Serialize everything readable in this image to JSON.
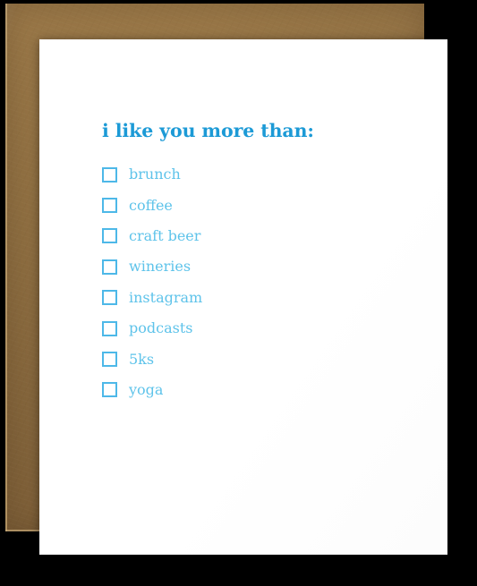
{
  "product_photo": {
    "background_color": "#000000",
    "envelope": {
      "label": "kraft-paper-envelope",
      "color": "#8e6e41"
    },
    "card": {
      "label": "greeting-card",
      "color": "#ffffff",
      "headline": "i like you more than:",
      "headline_color": "#1c9ad6",
      "item_color": "#5ec3ea",
      "checkbox_border_color": "#4db8e8",
      "checklist": [
        {
          "label": "brunch",
          "checked": false
        },
        {
          "label": "coffee",
          "checked": false
        },
        {
          "label": "craft beer",
          "checked": false
        },
        {
          "label": "wineries",
          "checked": false
        },
        {
          "label": "instagram",
          "checked": false
        },
        {
          "label": "podcasts",
          "checked": false
        },
        {
          "label": "5ks",
          "checked": false
        },
        {
          "label": "yoga",
          "checked": false
        }
      ]
    }
  }
}
